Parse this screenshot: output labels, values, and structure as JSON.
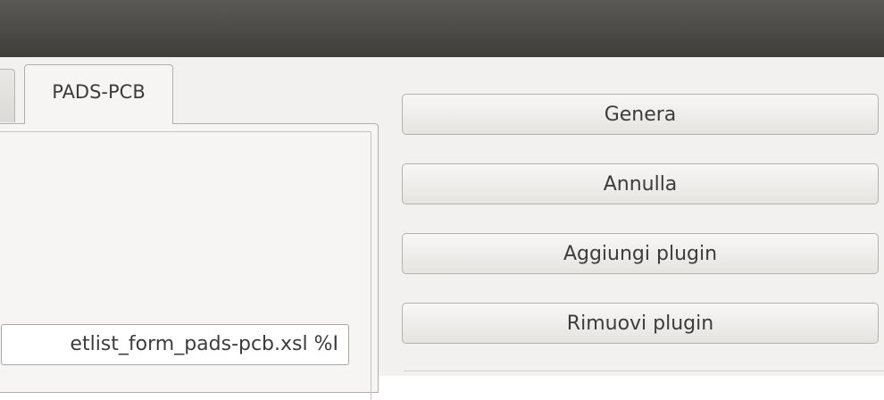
{
  "tabs": {
    "active_label": "PADS-PCB"
  },
  "command": {
    "visible_text": "etlist_form_pads-pcb.xsl %I"
  },
  "buttons": {
    "generate": "Genera",
    "cancel": "Annulla",
    "add_plugin": "Aggiungi plugin",
    "remove_plugin": "Rimuovi plugin"
  },
  "colors": {
    "titlebar": "#4a4945",
    "dialog_background": "#f2f1f0"
  }
}
